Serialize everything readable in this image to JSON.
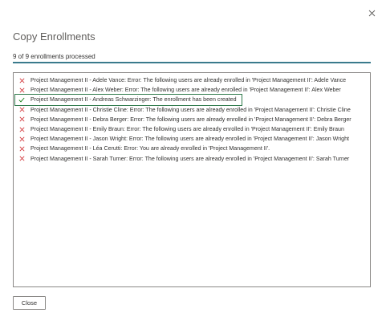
{
  "dialog": {
    "title": "Copy Enrollments",
    "close_icon": "close-icon",
    "progress_text": "9 of 9 enrollments processed",
    "progress": {
      "done": 9,
      "total": 9,
      "fraction": 1.0
    },
    "close_button_label": "Close"
  },
  "colors": {
    "error": "#d13438",
    "success": "#107c10",
    "progress": "#3a7a8c",
    "selected_outline": "#2f7a4b"
  },
  "results": [
    {
      "status": "error",
      "icon": "error-x-icon",
      "text": "Project Management II - Adele Vance: Error: The following users are already enrolled in 'Project Management II': Adele Vance"
    },
    {
      "status": "error",
      "icon": "error-x-icon",
      "text": "Project Management II - Alex Weber: Error: The following users are already enrolled in 'Project Management II': Alex Weber"
    },
    {
      "status": "success",
      "icon": "checkmark-icon",
      "text": "Project Management II - Andreas Schwarzinger: The enrollment has been created",
      "selected": true
    },
    {
      "status": "error",
      "icon": "error-x-icon",
      "text": "Project Management II - Christie Cline: Error: The following users are already enrolled in 'Project Management II': Christie Cline"
    },
    {
      "status": "error",
      "icon": "error-x-icon",
      "text": "Project Management II - Debra Berger: Error: The following users are already enrolled in 'Project Management II': Debra Berger"
    },
    {
      "status": "error",
      "icon": "error-x-icon",
      "text": "Project Management II - Emily Braun: Error: The following users are already enrolled in 'Project Management II': Emily Braun"
    },
    {
      "status": "error",
      "icon": "error-x-icon",
      "text": "Project Management II - Jason Wright: Error: The following users are already enrolled in 'Project Management II': Jason Wright"
    },
    {
      "status": "error",
      "icon": "error-x-icon",
      "text": "Project Management II - Léa Cerutti: Error: You are already enrolled in 'Project Management II'."
    },
    {
      "status": "error",
      "icon": "error-x-icon",
      "text": "Project Management II - Sarah Turner: Error: The following users are already enrolled in 'Project Management II': Sarah Turner"
    }
  ]
}
